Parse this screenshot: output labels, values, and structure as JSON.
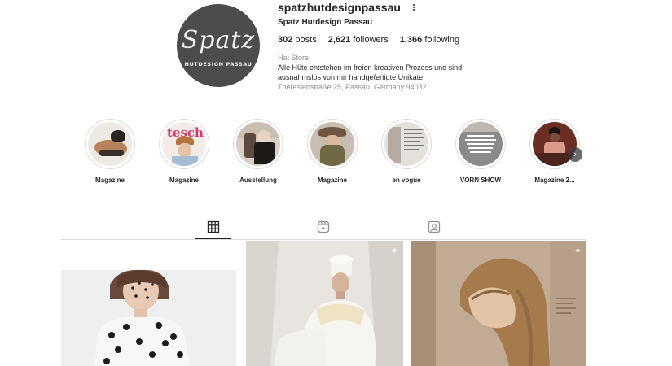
{
  "profile": {
    "username": "spatzhutdesignpassau",
    "full_name": "Spatz Hutdesign Passau",
    "avatar_script": "Spatz",
    "avatar_tagline": "HUTDESIGN PASSAU",
    "posts_count": "302",
    "posts_label": "posts",
    "followers_count": "2,621",
    "followers_label": "followers",
    "following_count": "1,366",
    "following_label": "following",
    "category": "Hat Store",
    "bio": "Alle Hüte entstehen im freien kreativen Prozess und sind ausnahmslos von mir handgefertigte Unikate.",
    "address": "Theresienstraße 25, Passau, Germany 94032"
  },
  "highlights": [
    {
      "label": "Magazine"
    },
    {
      "label": "Magazine"
    },
    {
      "label": "Ausstellung"
    },
    {
      "label": "Magazine"
    },
    {
      "label": "en vogue"
    },
    {
      "label": "VORN SHOW"
    },
    {
      "label": "Magazine 2..."
    }
  ],
  "tabs": [
    {
      "icon": "grid-icon",
      "active": true
    },
    {
      "icon": "reels-icon",
      "active": false
    },
    {
      "icon": "tagged-icon",
      "active": false
    }
  ],
  "highlight_texts": {
    "tesch": "tesch"
  },
  "colors": {
    "avatar_bg": "#4b4d4d",
    "text": "#262626",
    "muted": "#8e8e8e",
    "divider": "#dbdbdb"
  }
}
